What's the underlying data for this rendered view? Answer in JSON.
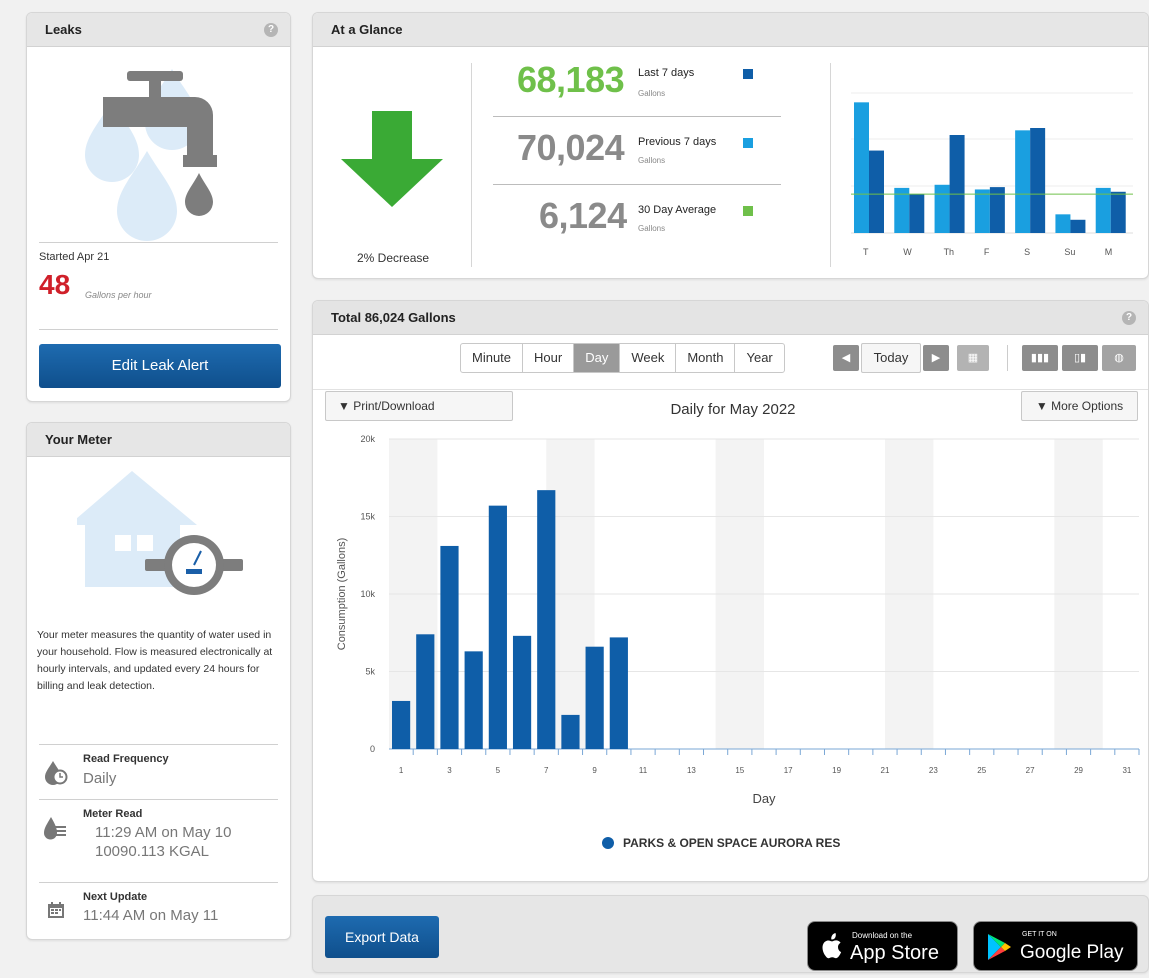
{
  "leaks": {
    "title": "Leaks",
    "started": "Started Apr 21",
    "rate": "48",
    "rate_unit": "Gallons per hour",
    "button": "Edit Leak Alert"
  },
  "meter": {
    "title": "Your Meter",
    "description": "Your meter measures the quantity of water used in your household. Flow is measured electronically at hourly intervals, and updated every 24 hours for billing and leak detection.",
    "read_frequency_label": "Read Frequency",
    "read_frequency_value": "Daily",
    "meter_read_label": "Meter Read",
    "meter_read_time": "11:29 AM on May 10",
    "meter_read_value": "10090.113 KGAL",
    "next_update_label": "Next Update",
    "next_update_value": "11:44 AM on May 11"
  },
  "glance": {
    "title": "At a Glance",
    "change_text": "2% Decrease",
    "last7_value": "68,183",
    "last7_label": "Last 7 days",
    "prev7_value": "70,024",
    "prev7_label": "Previous 7 days",
    "avg_value": "6,124",
    "avg_label": "30 Day Average",
    "unit": "Gallons",
    "colors": {
      "last7": "#0f5ea8",
      "prev7": "#1a9fe0",
      "avg": "#6fc04a",
      "decrease": "#3aaa35"
    },
    "mini_chart": {
      "type": "bar",
      "categories": [
        "T",
        "W",
        "Th",
        "F",
        "S",
        "Su",
        "M"
      ],
      "series": [
        {
          "values": [
            16.8,
            5.8,
            6.2,
            5.6,
            13.2,
            2.4,
            5.8
          ]
        },
        {
          "values": [
            10.6,
            5.0,
            12.6,
            5.9,
            13.5,
            1.7,
            5.3
          ]
        }
      ],
      "average": 5.0,
      "ylim": [
        0,
        18
      ]
    }
  },
  "total": {
    "title": "Total 86,024 Gallons",
    "periods": [
      "Minute",
      "Hour",
      "Day",
      "Week",
      "Month",
      "Year"
    ],
    "active_period": "Day",
    "today_label": "Today",
    "print_label": "▼  Print/Download",
    "more_label": "▼ More Options",
    "chart_title": "Daily for May 2022"
  },
  "chart_data": {
    "type": "bar",
    "title": "Daily for May 2022",
    "xlabel": "Day",
    "ylabel": "Consumption (Gallons)",
    "ylim": [
      0,
      20000
    ],
    "yticks": [
      "0",
      "5k",
      "10k",
      "15k",
      "20k"
    ],
    "x_tick_labels": [
      "1",
      "3",
      "5",
      "7",
      "9",
      "11",
      "13",
      "15",
      "17",
      "19",
      "21",
      "23",
      "25",
      "27",
      "29",
      "31"
    ],
    "categories": [
      1,
      2,
      3,
      4,
      5,
      6,
      7,
      8,
      9,
      10,
      11,
      12,
      13,
      14,
      15,
      16,
      17,
      18,
      19,
      20,
      21,
      22,
      23,
      24,
      25,
      26,
      27,
      28,
      29,
      30,
      31
    ],
    "series": [
      {
        "name": "PARKS & OPEN SPACE AURORA RES",
        "values": [
          3100,
          7400,
          13100,
          6300,
          15700,
          7300,
          16700,
          2200,
          6600,
          7200,
          0,
          0,
          0,
          0,
          0,
          0,
          0,
          0,
          0,
          0,
          0,
          0,
          0,
          0,
          0,
          0,
          0,
          0,
          0,
          0,
          0
        ]
      }
    ],
    "weekend_shading": true,
    "color": "#0f5ea8",
    "legend": "bottom-center"
  },
  "footer": {
    "export_label": "Export Data",
    "appstore_small": "Download on the",
    "appstore_big": "App Store",
    "googleplay_small": "GET IT ON",
    "googleplay_big": "Google Play"
  }
}
